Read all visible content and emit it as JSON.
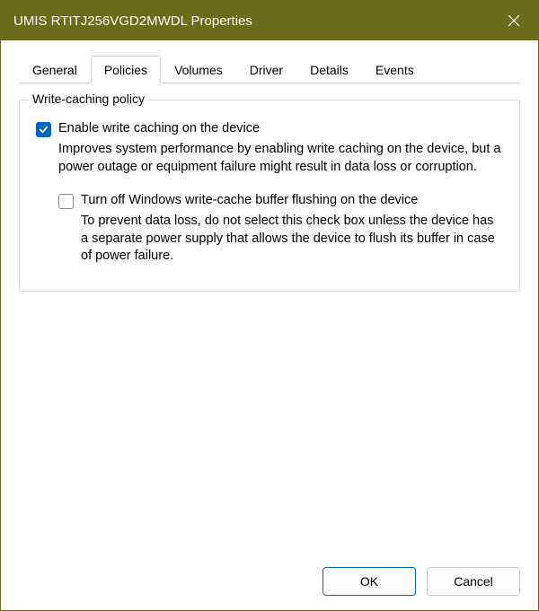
{
  "titlebar": {
    "title": "UMIS RTITJ256VGD2MWDL Properties"
  },
  "tabs": {
    "items": [
      {
        "label": "General"
      },
      {
        "label": "Policies"
      },
      {
        "label": "Volumes"
      },
      {
        "label": "Driver"
      },
      {
        "label": "Details"
      },
      {
        "label": "Events"
      }
    ],
    "active_index": 1
  },
  "policies": {
    "group_title": "Write-caching policy",
    "enable_write_cache": {
      "checked": true,
      "label": "Enable write caching on the device",
      "description": "Improves system performance by enabling write caching on the device, but a power outage or equipment failure might result in data loss or corruption."
    },
    "turn_off_flushing": {
      "checked": false,
      "label": "Turn off Windows write-cache buffer flushing on the device",
      "description": "To prevent data loss, do not select this check box unless the device has a separate power supply that allows the device to flush its buffer in case of power failure."
    }
  },
  "buttons": {
    "ok": "OK",
    "cancel": "Cancel"
  }
}
